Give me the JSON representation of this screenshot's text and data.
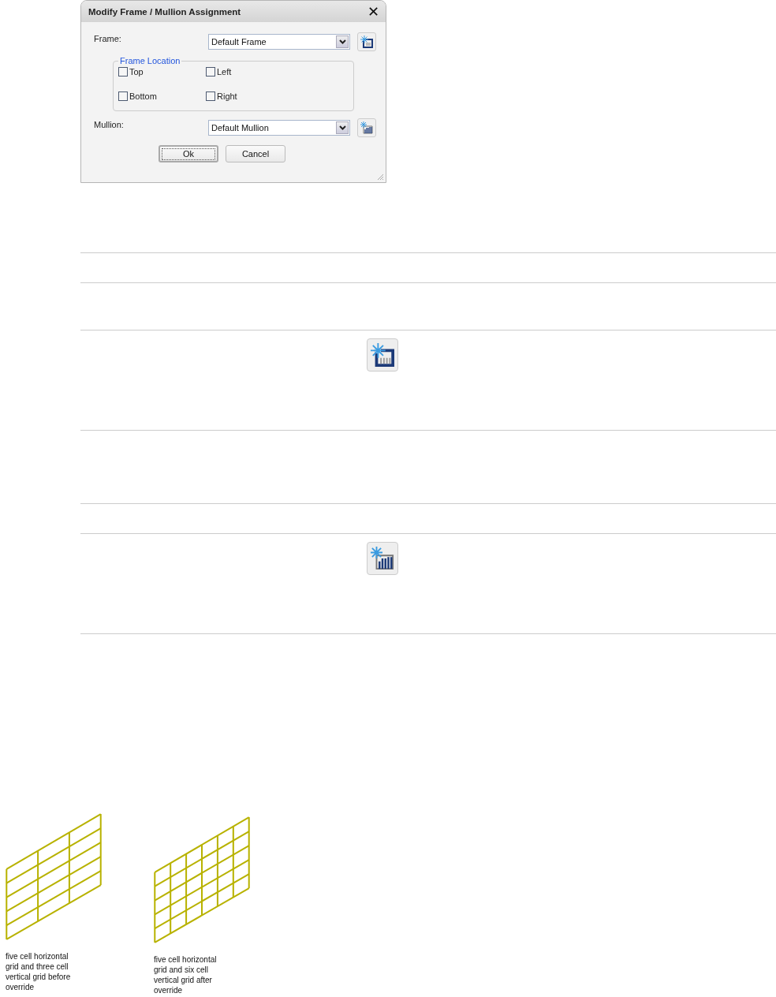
{
  "dialog": {
    "title": "Modify Frame / Mullion Assignment",
    "close": "✕",
    "frame": {
      "label": "Frame:",
      "value": "Default Frame"
    },
    "frame_location": {
      "legend": "Frame Location",
      "options": [
        {
          "label": "Top",
          "checked": false
        },
        {
          "label": "Left",
          "checked": false
        },
        {
          "label": "Bottom",
          "checked": false
        },
        {
          "label": "Right",
          "checked": false
        }
      ]
    },
    "mullion": {
      "label": "Mullion:",
      "value": "Default Mullion"
    },
    "buttons": [
      {
        "label": "Ok",
        "kind": "default"
      },
      {
        "label": "Cancel",
        "kind": "normal"
      }
    ]
  },
  "table": {
    "rows": [
      {
        "kind": "empty"
      },
      {
        "kind": "empty"
      },
      {
        "kind": "frame-button"
      },
      {
        "kind": "empty"
      },
      {
        "kind": "empty"
      },
      {
        "kind": "mullion-button"
      }
    ]
  },
  "figures": [
    {
      "caption": "five cell horizontal grid and three cell vertical grid before override"
    },
    {
      "caption": "five cell horizontal grid and six cell vertical grid after override"
    }
  ]
}
